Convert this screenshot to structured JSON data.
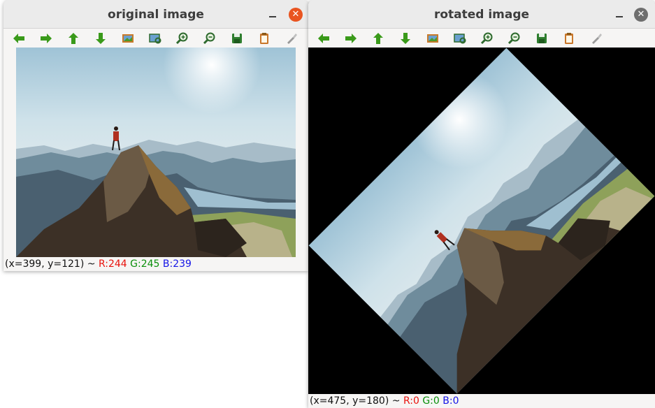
{
  "windows": [
    {
      "title": "original image",
      "status": {
        "coords": "(x=399, y=121) ~ ",
        "r": "R:244",
        "g": "G:245",
        "b": "B:239"
      }
    },
    {
      "title": "rotated image",
      "status": {
        "coords": "(x=475, y=180) ~ ",
        "r": "R:0",
        "g": "G:0",
        "b": "B:0"
      }
    }
  ],
  "toolbar_icons": [
    "pan-left-icon",
    "pan-right-icon",
    "pan-up-icon",
    "pan-down-icon",
    "zoom-fit-icon",
    "zoom-original-icon",
    "zoom-in-icon",
    "zoom-out-icon",
    "save-icon",
    "copy-icon",
    "properties-icon"
  ],
  "window_controls": {
    "minimize": "–",
    "close": "✕"
  },
  "colors": {
    "title_close_active": "#e95420",
    "title_close_inactive": "#6e6e6e",
    "arrow_green": "#3a9a1a",
    "rotated_background": "#000000"
  }
}
